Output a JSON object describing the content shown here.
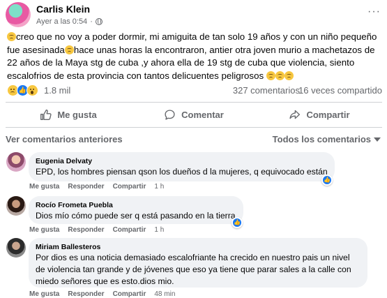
{
  "post": {
    "author": "Carlis Klein",
    "timestamp": "Ayer a las 0:54",
    "text_lines": [
      "creo que no voy a poder dormir, mi amiguita de tan solo 19 años y con un niño pequeño fue",
      "asesinada",
      "hace unas horas la encontraron, antier otra joven murio a machetazos de 22 años de",
      "la Maya stg de cuba ,y ahora ella de 19 stg de cuba que violencia, siento escalofrios de esta",
      "provincia con tantos delicuentes peligrosos"
    ],
    "reaction_count": "1.8 mil",
    "comments_count": "327 comentarios",
    "shares_count": "16 veces compartido"
  },
  "actions": {
    "like": "Me gusta",
    "comment": "Comentar",
    "share": "Compartir"
  },
  "comments_section": {
    "prev_label": "Ver comentarios anteriores",
    "filter_label": "Todos los comentarios"
  },
  "comment_actions": {
    "like": "Me gusta",
    "reply": "Responder",
    "share": "Compartir"
  },
  "comments": [
    {
      "name": "Eugenia Delvaty",
      "text": "EPD, los hombres piensan qson los dueños d la mujeres, q equivocado están",
      "time": "1 h"
    },
    {
      "name": "Rocío Frometa Puebla",
      "text": "Dios mío cómo puede ser q está pasando en la tierra",
      "time": "1 h"
    },
    {
      "name": "Miriam Ballesteros",
      "text_lines": [
        "Por dios es una noticia demasiado escalofriante ha crecido en nuestro pais un nivel",
        "de violencia tan grande y de jóvenes que eso ya tiene que parar sales a la calle con",
        "miedo señores que es esto.dios mio."
      ],
      "time": "48 min"
    }
  ],
  "colors": {
    "accent": "#1877f2",
    "secondary_text": "#65676b",
    "bubble": "#f0f2f5"
  }
}
